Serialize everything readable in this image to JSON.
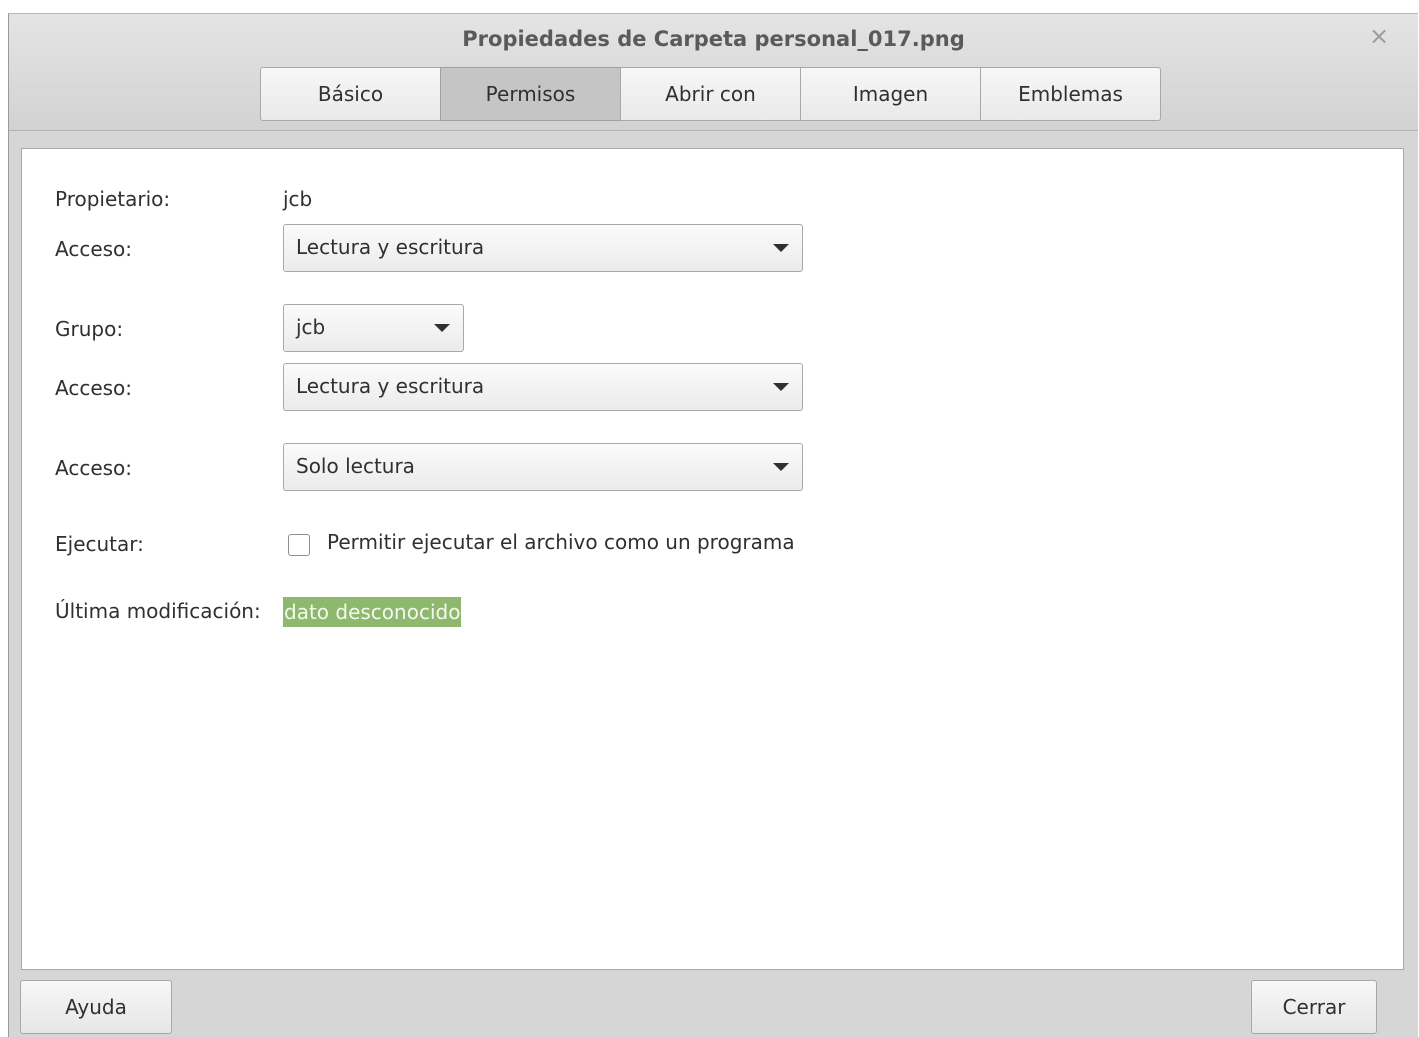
{
  "window": {
    "title": "Propiedades de Carpeta personal_017.png",
    "close_glyph": "×"
  },
  "tabs": [
    {
      "label": "Básico",
      "active": false
    },
    {
      "label": "Permisos",
      "active": true
    },
    {
      "label": "Abrir con",
      "active": false
    },
    {
      "label": "Imagen",
      "active": false
    },
    {
      "label": "Emblemas",
      "active": false
    }
  ],
  "permissions": {
    "owner_label": "Propietario:",
    "owner_value": "jcb",
    "owner_access_label": "Acceso:",
    "owner_access_value": "Lectura y escritura",
    "group_label": "Grupo:",
    "group_value": "jcb",
    "group_access_label": "Acceso:",
    "group_access_value": "Lectura y escritura",
    "others_access_label": "Acceso:",
    "others_access_value": "Solo lectura",
    "execute_label": "Ejecutar:",
    "execute_checkbox_label": "Permitir ejecutar el archivo como un programa",
    "execute_checked": false,
    "modified_label": "Última modificación:",
    "modified_value": "dato desconocido"
  },
  "buttons": {
    "help": "Ayuda",
    "close": "Cerrar"
  },
  "colors": {
    "highlight": "#8fb86f",
    "active_tab": "#c5c5c5"
  }
}
